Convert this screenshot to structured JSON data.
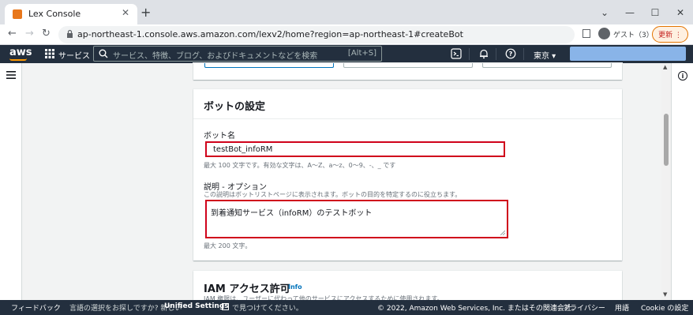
{
  "browser": {
    "tab_title": "Lex Console",
    "url": "ap-northeast-1.console.aws.amazon.com/lexv2/home?region=ap-northeast-1#createBot",
    "profile_label": "ゲスト（3）",
    "update_label": "更新 ⋮",
    "window_controls": [
      "⌄",
      "—",
      "☐",
      "✕"
    ]
  },
  "aws_nav": {
    "logo": "aws",
    "services_label": "サービス",
    "search_placeholder": "サービス、特徴、ブログ、およびドキュメントなどを検索",
    "search_shortcut": "[Alt+S]",
    "region": "東京 ▾"
  },
  "bot_settings": {
    "heading": "ボットの設定",
    "name_label": "ボット名",
    "name_value": "testBot_infoRM",
    "name_hint": "最大 100 文字です。有効な文字は、A～Z、a～z、0～9、-、_ です",
    "description_label": "説明 - オプション",
    "description_hint": "この説明はボットリストページに表示されます。ボットの目的を特定するのに役立ちます。",
    "description_value": "到着通知サービス（infoRM）のテストボット",
    "description_count": "最大 200 文字。"
  },
  "iam": {
    "heading": "IAM アクセス許可",
    "info_link": "Info",
    "subtext": "IAM 権限は、ユーザーに代わって他のサービスにアクセスするために使用されます。"
  },
  "footer": {
    "feedback": "フィードバック",
    "lang_prompt": "言語の選択をお探しですか? 新しい",
    "unified_settings": "Unified Settings",
    "lang_tail": "で見つけてください。",
    "copyright": "© 2022, Amazon Web Services, Inc. またはその関連会社。",
    "privacy": "プライバシー",
    "terms": "用語",
    "cookie": "Cookie の設定"
  },
  "colors": {
    "aws_nav": "#232f3e",
    "highlight_border": "#d0021b",
    "link": "#0073bb"
  }
}
